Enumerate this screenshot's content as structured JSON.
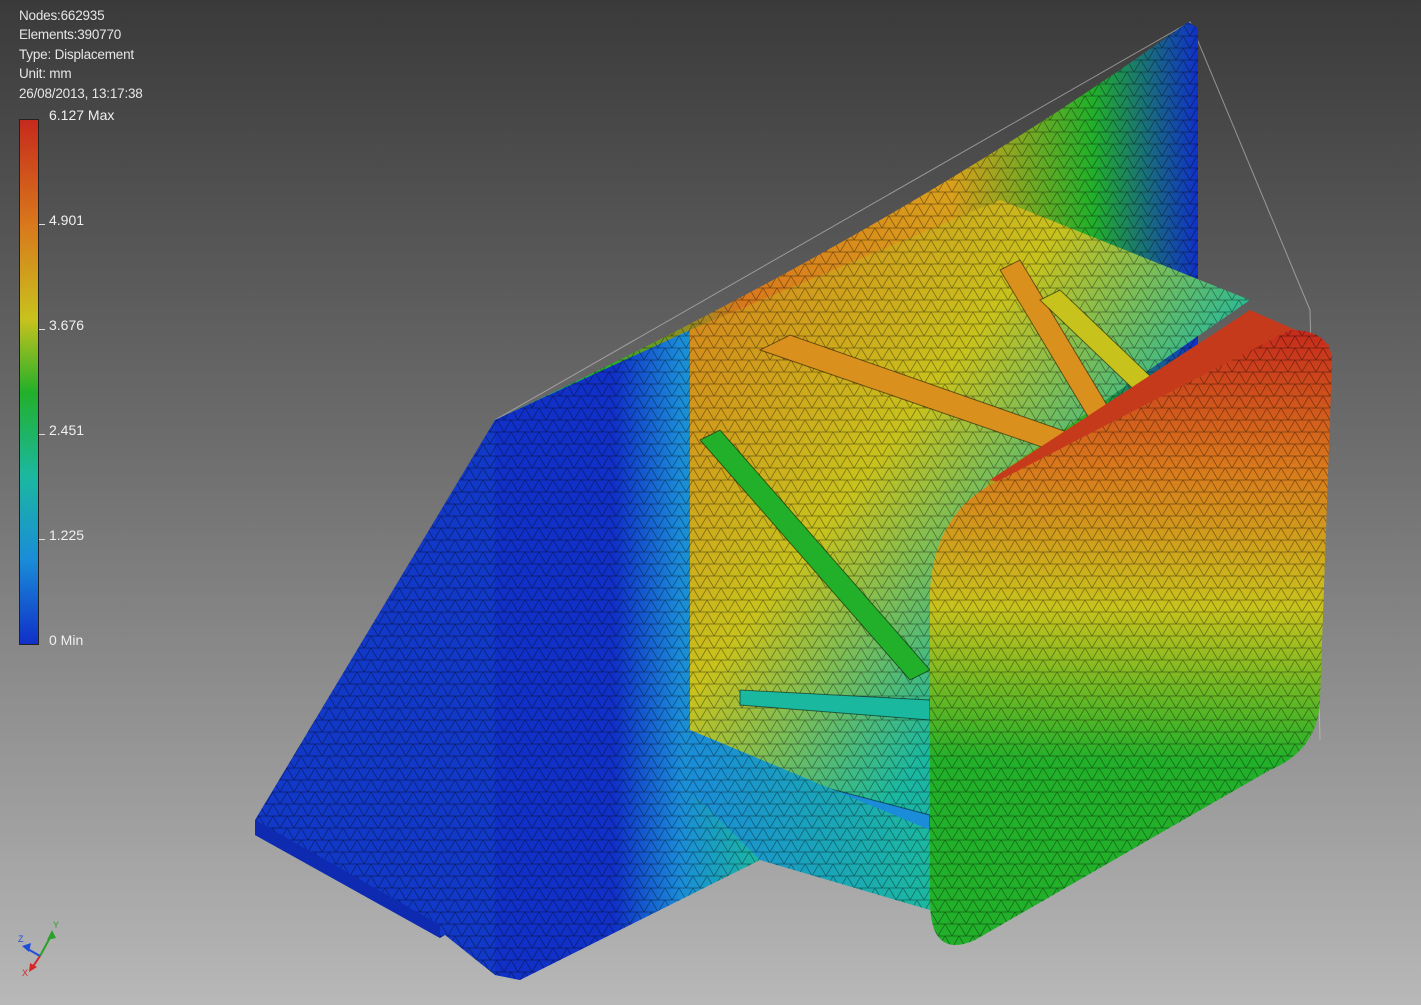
{
  "info": {
    "nodes": "Nodes:662935",
    "elements": "Elements:390770",
    "type": "Type: Displacement",
    "unit": "Unit: mm",
    "timestamp": "26/08/2013, 13:17:38"
  },
  "legend": {
    "max_label": "6.127 Max",
    "ticks": [
      "4.901",
      "3.676",
      "2.451",
      "1.225"
    ],
    "min_label": "0 Min",
    "colors": [
      "#c62a1c",
      "#d9781c",
      "#c8c21d",
      "#22b02a",
      "#1bb8a0",
      "#1a8cd8",
      "#1030c8"
    ]
  },
  "triad": {
    "x_label": "X",
    "y_label": "Y",
    "z_label": "Z"
  },
  "model": {
    "colors": {
      "low": "#1030c8",
      "mid": "#22b02a",
      "high": "#c62a1c"
    }
  }
}
